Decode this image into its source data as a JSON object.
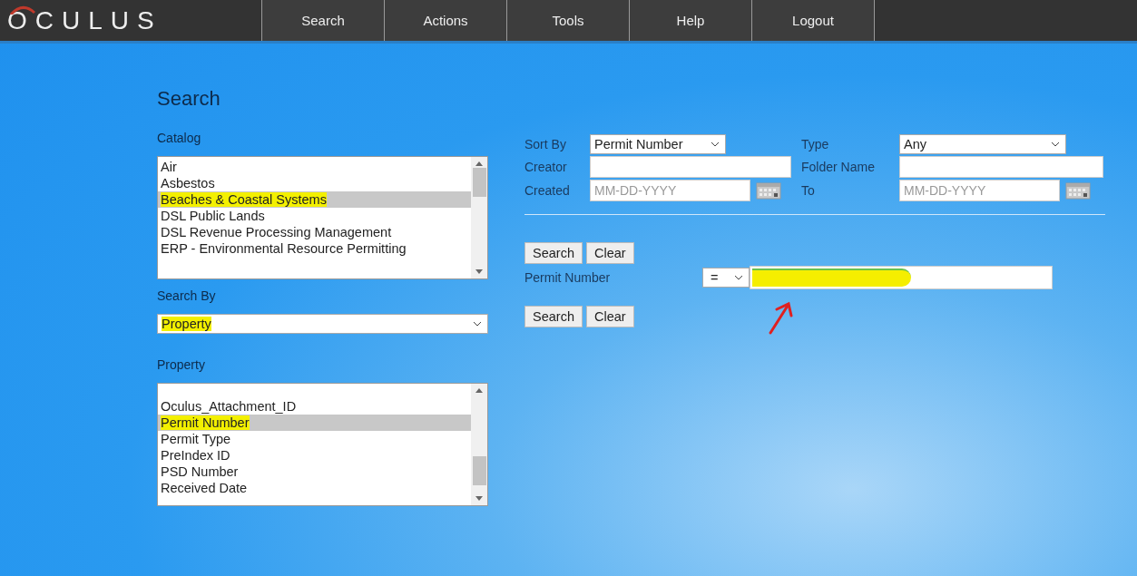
{
  "logo": "OCULUS",
  "menu": [
    {
      "label": "Search"
    },
    {
      "label": "Actions"
    },
    {
      "label": "Tools"
    },
    {
      "label": "Help"
    },
    {
      "label": "Logout"
    }
  ],
  "page_title": "Search",
  "catalog": {
    "label": "Catalog",
    "items": [
      {
        "label": "Air",
        "selected": false,
        "highlighted": false
      },
      {
        "label": "Asbestos",
        "selected": false,
        "highlighted": false
      },
      {
        "label": "Beaches & Coastal Systems",
        "selected": true,
        "highlighted": true
      },
      {
        "label": "DSL Public Lands",
        "selected": false,
        "highlighted": false
      },
      {
        "label": "DSL Revenue Processing Management",
        "selected": false,
        "highlighted": false
      },
      {
        "label": "ERP - Environmental Resource Permitting",
        "selected": false,
        "highlighted": false
      }
    ]
  },
  "search_by": {
    "label": "Search By",
    "value": "Property",
    "highlighted": true
  },
  "property": {
    "label": "Property",
    "items": [
      {
        "label": "Oculus_Attachment_ID",
        "selected": false,
        "highlighted": false
      },
      {
        "label": "Permit Number",
        "selected": true,
        "highlighted": true
      },
      {
        "label": "Permit Type",
        "selected": false,
        "highlighted": false
      },
      {
        "label": "PreIndex ID",
        "selected": false,
        "highlighted": false
      },
      {
        "label": "PSD Number",
        "selected": false,
        "highlighted": false
      },
      {
        "label": "Received Date",
        "selected": false,
        "highlighted": false
      }
    ]
  },
  "filters": {
    "sort_by": {
      "label": "Sort By",
      "value": "Permit Number"
    },
    "type": {
      "label": "Type",
      "value": "Any"
    },
    "creator": {
      "label": "Creator"
    },
    "folder_name": {
      "label": "Folder Name"
    },
    "created": {
      "label": "Created",
      "placeholder": "MM-DD-YYYY"
    },
    "to": {
      "label": "To",
      "placeholder": "MM-DD-YYYY"
    }
  },
  "buttons": [
    "Search",
    "Clear"
  ],
  "criterion": {
    "label": "Permit Number",
    "operator": "=",
    "highlighted": true
  },
  "buttons_bottom": [
    "Search",
    "Clear"
  ]
}
